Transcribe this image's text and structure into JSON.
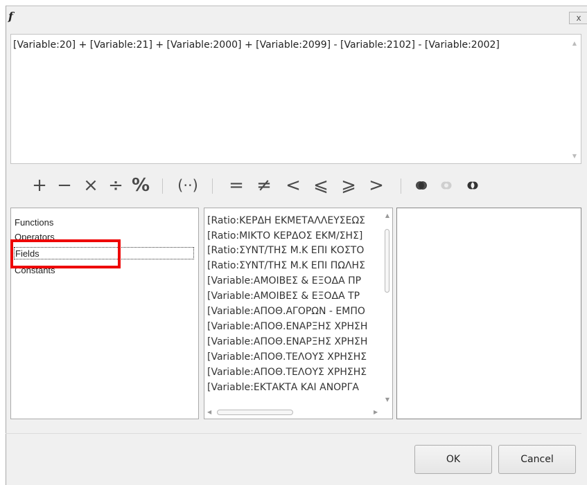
{
  "window": {
    "title_icon": "fx-icon",
    "title_icon_glyph": "f",
    "close_glyph": "x"
  },
  "expression": {
    "text": "[Variable:20] + [Variable:21] + [Variable:2000] + [Variable:2099] - [Variable:2102] - [Variable:2002]"
  },
  "toolbar": {
    "plus": "+",
    "minus": "−",
    "multiply": "×",
    "divide": "÷",
    "percent": "%",
    "parentheses": "(··)",
    "equal": "=",
    "not_equal": "≠",
    "less": "<",
    "less_equal": "⩽",
    "greater_equal": "⩾",
    "greater": ">",
    "and_icon": "and-icon",
    "or_icon": "or-icon",
    "not_icon": "not-icon"
  },
  "categories": {
    "items": [
      "Functions",
      "Operators",
      "Fields",
      "Constants"
    ],
    "selected": "Fields"
  },
  "fields": {
    "items": [
      "[Ratio:ΚΕΡΔΗ ΕΚΜΕΤΑΛΛΕΥΣΕΩΣ",
      "[Ratio:ΜΙΚΤΟ ΚΕΡΔΟΣ ΕΚΜ/ΣΗΣ]",
      "[Ratio:ΣΥΝΤ/ΤΗΣ Μ.Κ ΕΠΙ ΚΟΣΤΟ",
      "[Ratio:ΣΥΝΤ/ΤΗΣ Μ.Κ ΕΠΙ ΠΩΛΗΣ",
      "[Variable:ΑΜΟΙΒΕΣ & ΕΞΟΔΑ ΠΡ",
      "[Variable:ΑΜΟΙΒΕΣ & ΕΞΟΔΑ ΤΡ",
      "[Variable:ΑΠΟΘ.ΑΓΟΡΩΝ - ΕΜΠΟ",
      "[Variable:ΑΠΟΘ.ΕΝΑΡΞΗΣ ΧΡΗΣΗ",
      "[Variable:ΑΠΟΘ.ΕΝΑΡΞΗΣ ΧΡΗΣΗ",
      "[Variable:ΑΠΟΘ.ΤΕΛΟΥΣ ΧΡΗΣΗΣ",
      "[Variable:ΑΠΟΘ.ΤΕΛΟΥΣ ΧΡΗΣΗΣ",
      "[Variable:ΕΚΤΑΚΤΑ ΚΑΙ ΑΝΟΡΓΑ"
    ]
  },
  "buttons": {
    "ok": "OK",
    "cancel": "Cancel"
  },
  "colors": {
    "highlight": "#ee0000",
    "operator": "#4a4a4a"
  }
}
